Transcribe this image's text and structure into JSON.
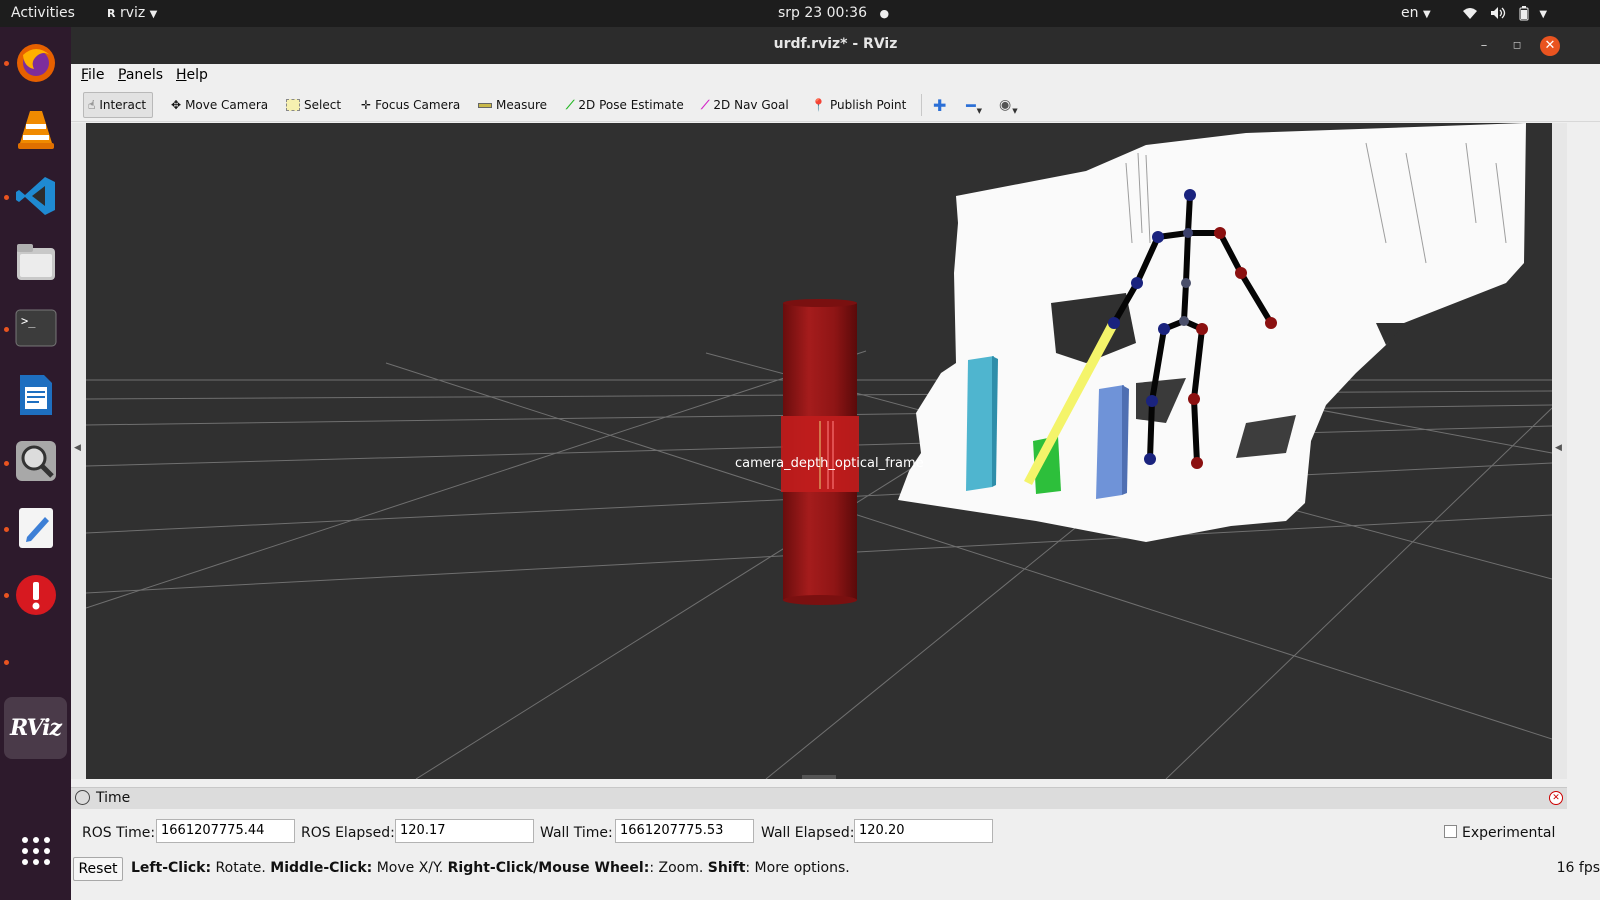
{
  "topbar": {
    "activities": "Activities",
    "app_name": "rviz",
    "datetime": "srp 23  00:36",
    "lang": "en"
  },
  "window": {
    "title": "urdf.rviz* - RViz"
  },
  "menu": {
    "file": "File",
    "panels": "Panels",
    "help": "Help"
  },
  "toolbar": {
    "interact": "Interact",
    "move_camera": "Move Camera",
    "select": "Select",
    "focus_camera": "Focus Camera",
    "measure": "Measure",
    "pose_estimate": "2D Pose Estimate",
    "nav_goal": "2D Nav Goal",
    "publish_point": "Publish Point"
  },
  "viewport": {
    "overlay_label": "camera_depth_optical_frame"
  },
  "time_panel": {
    "title": "Time",
    "ros_time_label": "ROS Time:",
    "ros_time_value": "1661207775.44",
    "ros_elapsed_label": "ROS Elapsed:",
    "ros_elapsed_value": "120.17",
    "wall_time_label": "Wall Time:",
    "wall_time_value": "1661207775.53",
    "wall_elapsed_label": "Wall Elapsed:",
    "wall_elapsed_value": "120.20",
    "experimental_label": "Experimental"
  },
  "status": {
    "reset": "Reset",
    "hint_b1": "Left-Click:",
    "hint_t1": " Rotate. ",
    "hint_b2": "Middle-Click:",
    "hint_t2": " Move X/Y. ",
    "hint_b3": "Right-Click/Mouse Wheel:",
    "hint_t3": ": Zoom. ",
    "hint_b4": "Shift",
    "hint_t4": ": More options.",
    "fps": "16 fps"
  },
  "dock": {
    "rviz_label": "RViz",
    "icons": [
      "firefox-icon",
      "vlc-icon",
      "vscode-icon",
      "files-icon",
      "terminal-icon",
      "writer-icon",
      "search-icon",
      "text-editor-icon",
      "update-alert-icon",
      "rviz-icon",
      "apps-grid-icon"
    ]
  },
  "colors": {
    "accent": "#e95420",
    "dock_bg": "#2d1a2c",
    "viewport_bg": "#303030"
  }
}
